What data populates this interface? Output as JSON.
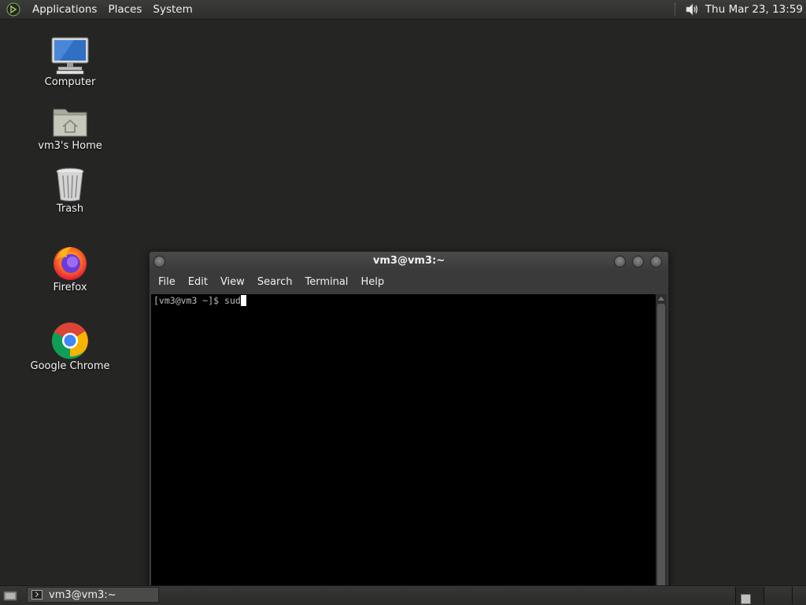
{
  "top_panel": {
    "menus": [
      "Applications",
      "Places",
      "System"
    ],
    "clock": "Thu Mar 23, 13:59",
    "icons": {
      "logo": "gnome-foot-icon",
      "volume": "speaker-icon"
    }
  },
  "desktop": {
    "icons": [
      {
        "label": "Computer",
        "icon": "computer-icon"
      },
      {
        "label": "vm3's Home",
        "icon": "home-folder-icon"
      },
      {
        "label": "Trash",
        "icon": "trash-icon"
      },
      {
        "label": "Firefox",
        "icon": "firefox-icon"
      },
      {
        "label": "Google Chrome",
        "icon": "chrome-icon"
      }
    ]
  },
  "terminal": {
    "title": "vm3@vm3:~",
    "menus": [
      "File",
      "Edit",
      "View",
      "Search",
      "Terminal",
      "Help"
    ],
    "prompt": "[vm3@vm3 ~]$ ",
    "input": "sud"
  },
  "taskbar": {
    "task_label": "vm3@vm3:~"
  },
  "colors": {
    "desktop_bg": "#252624",
    "panel_bg": "#333432",
    "terminal_bg": "#000000",
    "terminal_text": "#bdbdbd"
  }
}
